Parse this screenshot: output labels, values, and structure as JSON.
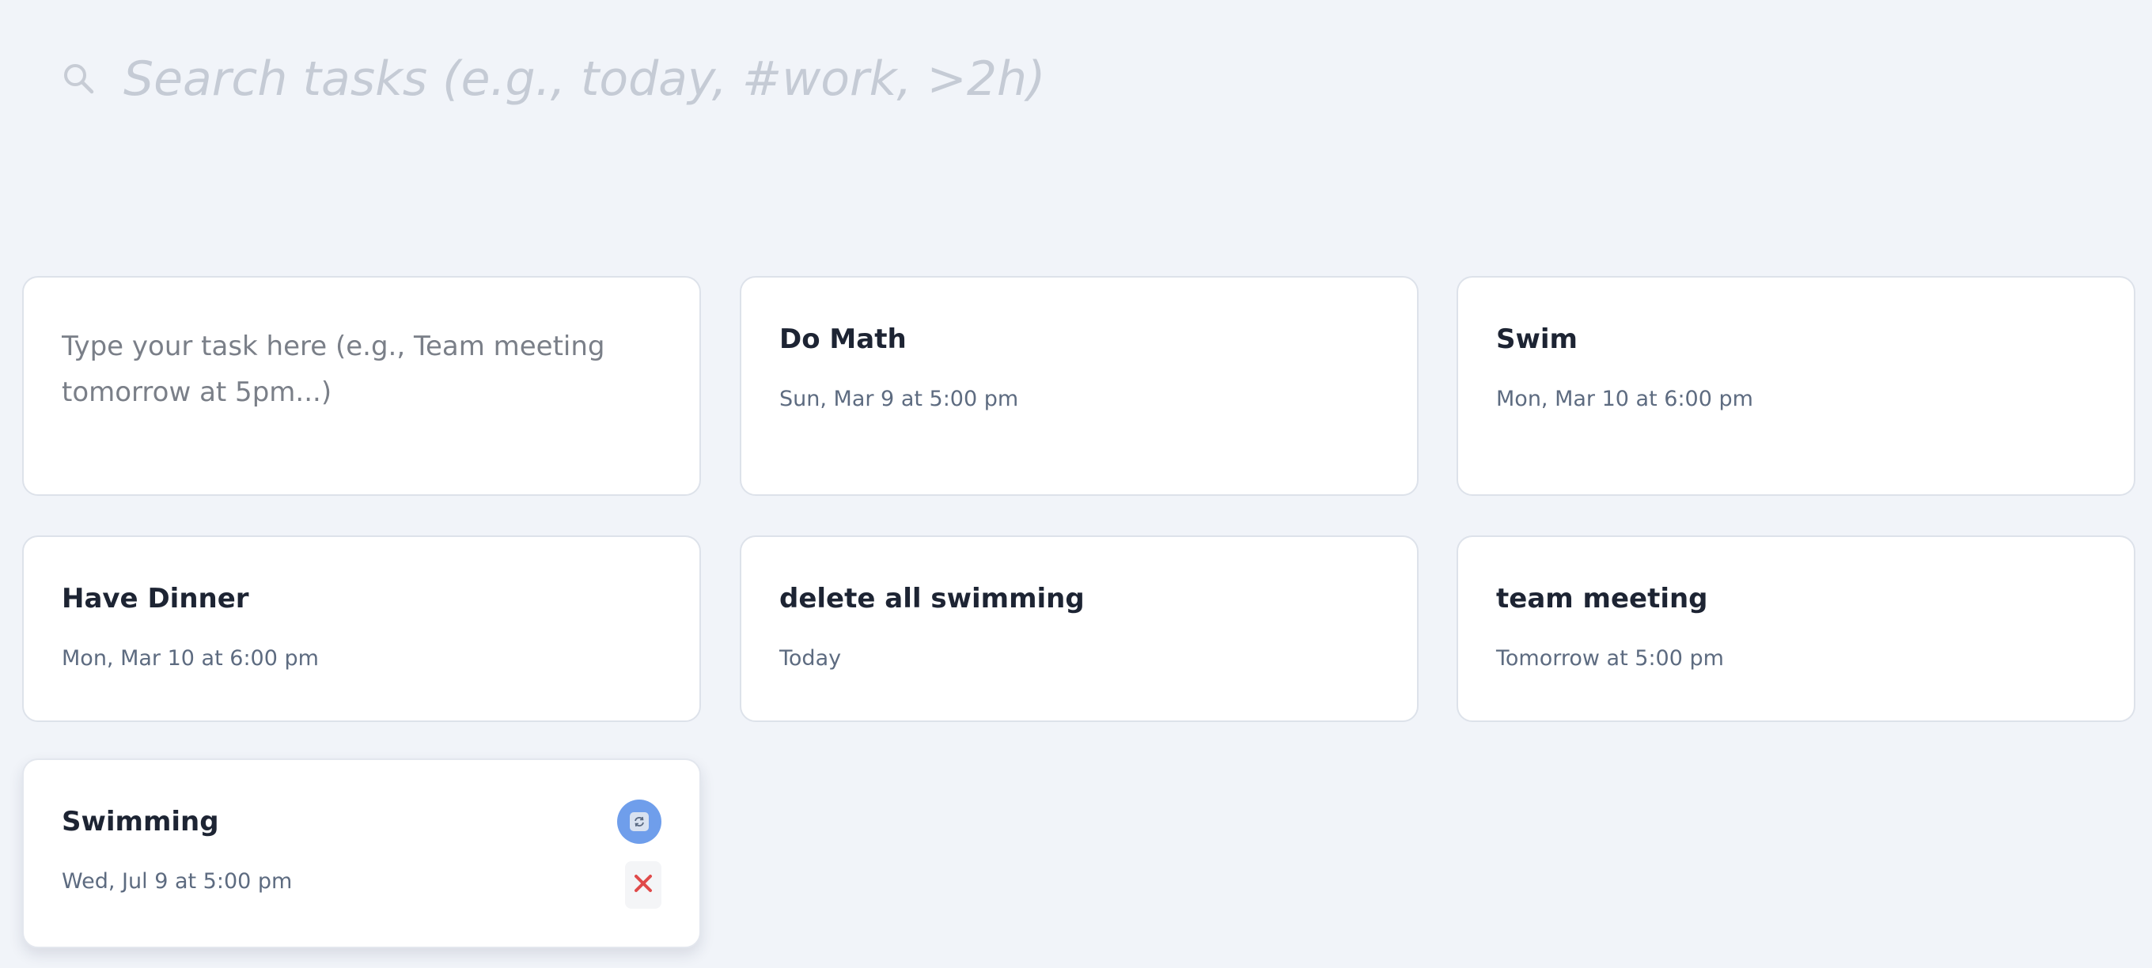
{
  "search": {
    "placeholder": "Search tasks (e.g., today, #work, >2h)",
    "value": ""
  },
  "new_task": {
    "placeholder": "Type your task here (e.g., Team meeting tomorrow at 5pm...)",
    "value": ""
  },
  "tasks": [
    {
      "title": "Do Math",
      "date": "Sun, Mar 9 at 5:00 pm"
    },
    {
      "title": "Swim",
      "date": "Mon, Mar 10 at 6:00 pm"
    },
    {
      "title": "Have Dinner",
      "date": "Mon, Mar 10 at 6:00 pm"
    },
    {
      "title": "delete all swimming",
      "date": "Today"
    },
    {
      "title": "team meeting",
      "date": "Tomorrow at 5:00 pm"
    },
    {
      "title": "Swimming",
      "date": "Wed, Jul 9 at 5:00 pm"
    }
  ],
  "icons": {
    "search": "search-icon",
    "recurring": "recurring-icon",
    "delete": "close-icon"
  },
  "colors": {
    "background": "#f1f4f9",
    "card": "#ffffff",
    "accent": "#6f9eeb",
    "delete": "#e04a4a",
    "title": "#1d2433",
    "date": "#5d6b80"
  }
}
